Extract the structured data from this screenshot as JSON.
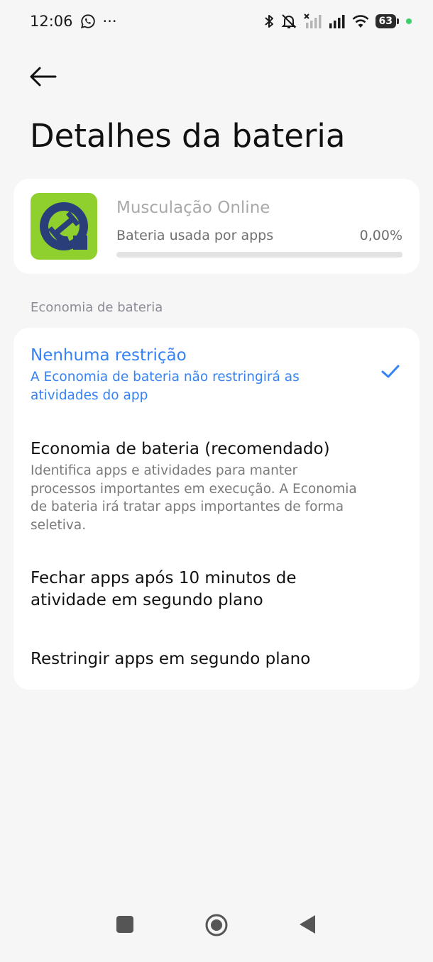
{
  "status_bar": {
    "time": "12:06",
    "more": "···",
    "battery_level": "63",
    "icons": [
      "whatsapp-icon",
      "bluetooth-icon",
      "notifications-muted-icon",
      "no-signal-icon",
      "signal-icon",
      "wifi-icon"
    ]
  },
  "header": {
    "title": "Detalhes da bateria"
  },
  "app": {
    "name": "Musculação Online",
    "usage_label": "Bateria usada por apps",
    "usage_value": "0,00%",
    "usage_fraction": 0.0
  },
  "section": {
    "label": "Economia de bateria"
  },
  "options": [
    {
      "title": "Nenhuma restrição",
      "description": "A Economia de bateria não restringirá as atividades do app",
      "selected": true
    },
    {
      "title": "Economia de bateria (recomendado)",
      "description": "Identifica apps e atividades para manter processos importantes em execução. A Economia de bateria irá tratar apps importantes de forma seletiva.",
      "selected": false
    },
    {
      "title": "Fechar apps após 10 minutos de atividade em segundo plano",
      "description": "",
      "selected": false
    },
    {
      "title": "Restringir apps em segundo plano",
      "description": "",
      "selected": false
    }
  ],
  "colors": {
    "accent": "#3482f6",
    "background": "#f6f6f6",
    "card": "#ffffff",
    "app_icon_green": "#8fcf2e",
    "app_icon_navy": "#2a3f7a"
  }
}
